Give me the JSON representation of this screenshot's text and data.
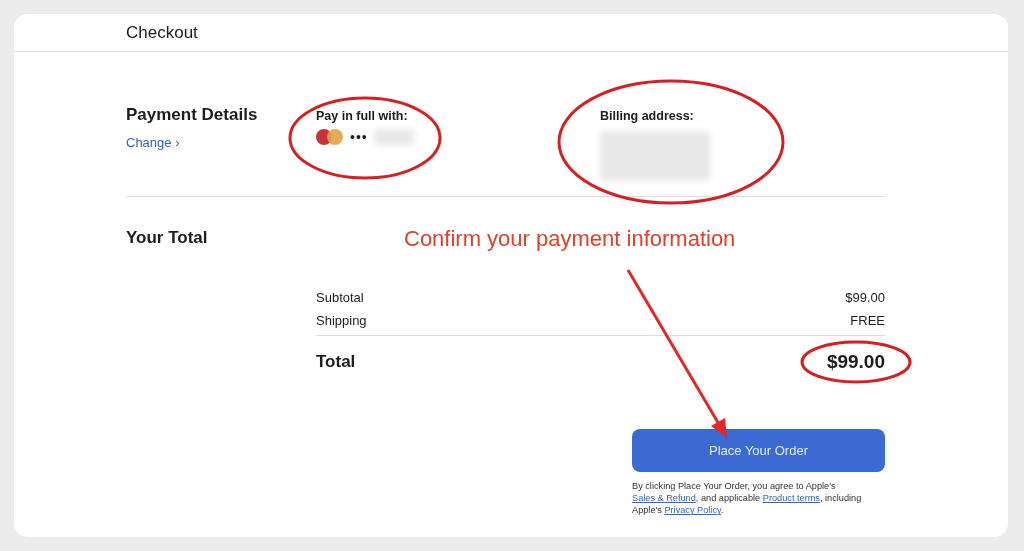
{
  "window": {
    "title": "Checkout"
  },
  "payment": {
    "heading": "Payment Details",
    "change_link": "Change ›",
    "pay_label": "Pay in full with:",
    "card_dots": "•••",
    "billing_label": "Billing address:"
  },
  "total": {
    "heading": "Your Total",
    "rows": [
      {
        "label": "Subtotal",
        "value": "$99.00"
      },
      {
        "label": "Shipping",
        "value": "FREE"
      }
    ],
    "total_label": "Total",
    "total_value": "$99.00"
  },
  "order_button": "Place Your Order",
  "legal": {
    "before": "By clicking Place Your Order, you agree to Apple's ",
    "link1": "Sales & Refund",
    "middle": ", and applicable ",
    "link2": "Product terms",
    "after": ", including Apple's ",
    "link3": "Privacy Policy",
    "end": "."
  },
  "annotation": {
    "note": "Confirm your payment information"
  }
}
